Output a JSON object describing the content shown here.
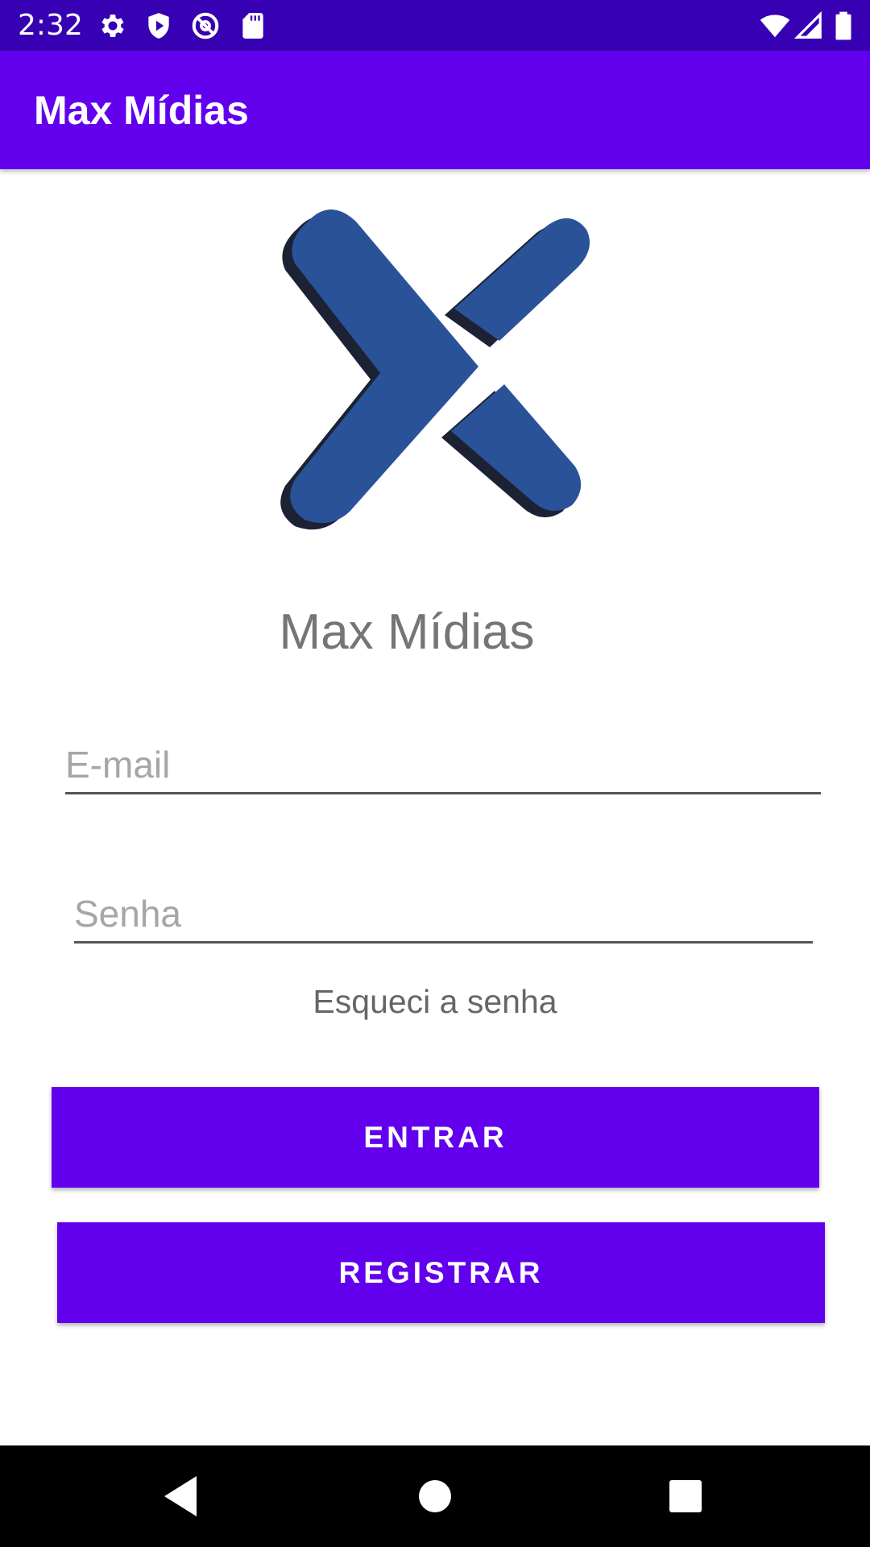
{
  "status_bar": {
    "time": "2:32",
    "icons": [
      "gear-icon",
      "shield-play-icon",
      "at-sign-icon",
      "sd-card-icon",
      "wifi-icon",
      "signal-icon",
      "battery-icon"
    ]
  },
  "app_bar": {
    "title": "Max Mídias"
  },
  "logo": {
    "icon": "x-logo-icon",
    "colors": {
      "primary": "#2a5298",
      "shadow": "#1c2233"
    }
  },
  "brand": {
    "name": "Max Mídias"
  },
  "form": {
    "email": {
      "placeholder": "E-mail",
      "value": ""
    },
    "password": {
      "placeholder": "Senha",
      "value": ""
    },
    "forgot_password": "Esqueci a senha"
  },
  "buttons": {
    "enter": "ENTRAR",
    "register": "REGISTRAR"
  },
  "nav": {
    "icons": [
      "back-triangle-icon",
      "home-circle-icon",
      "recents-square-icon"
    ]
  },
  "colors": {
    "status_bar": "#3700b3",
    "primary": "#6200ee",
    "text_secondary": "#757575"
  }
}
